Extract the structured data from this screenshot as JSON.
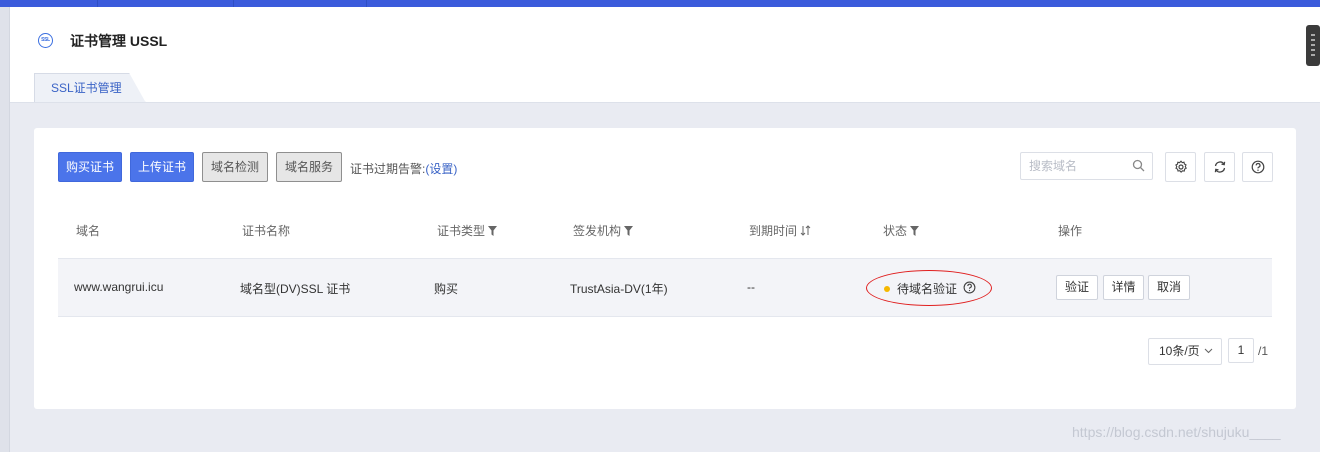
{
  "header": {
    "brand_icon_text": "SSL",
    "title": "证书管理 USSL",
    "tab_label": "SSL证书管理"
  },
  "toolbar": {
    "buy_label": "购买证书",
    "upload_label": "上传证书",
    "check_label": "域名检测",
    "service_label": "域名服务",
    "alert_prefix": "证书过期告警:",
    "alert_link": "(设置)",
    "search_placeholder": "搜索域名"
  },
  "table": {
    "columns": [
      "域名",
      "证书名称",
      "证书类型",
      "签发机构",
      "到期时间",
      "状态",
      "操作"
    ],
    "rows": [
      {
        "domain": "www.wangrui.icu",
        "cert_name": "域名型(DV)SSL 证书",
        "cert_type": "购买",
        "issuer": "TrustAsia-DV(1年)",
        "expire": "--",
        "status": "待域名验证",
        "actions": [
          "验证",
          "详情",
          "取消"
        ]
      }
    ]
  },
  "pagination": {
    "page_size": "10条/页",
    "current_page": "1",
    "total": "/1"
  },
  "watermark": "https://blog.csdn.net/shujuku____",
  "colors": {
    "primary": "#4b74ea",
    "status_pending": "#f5b800",
    "highlight_circle": "#e02020"
  }
}
